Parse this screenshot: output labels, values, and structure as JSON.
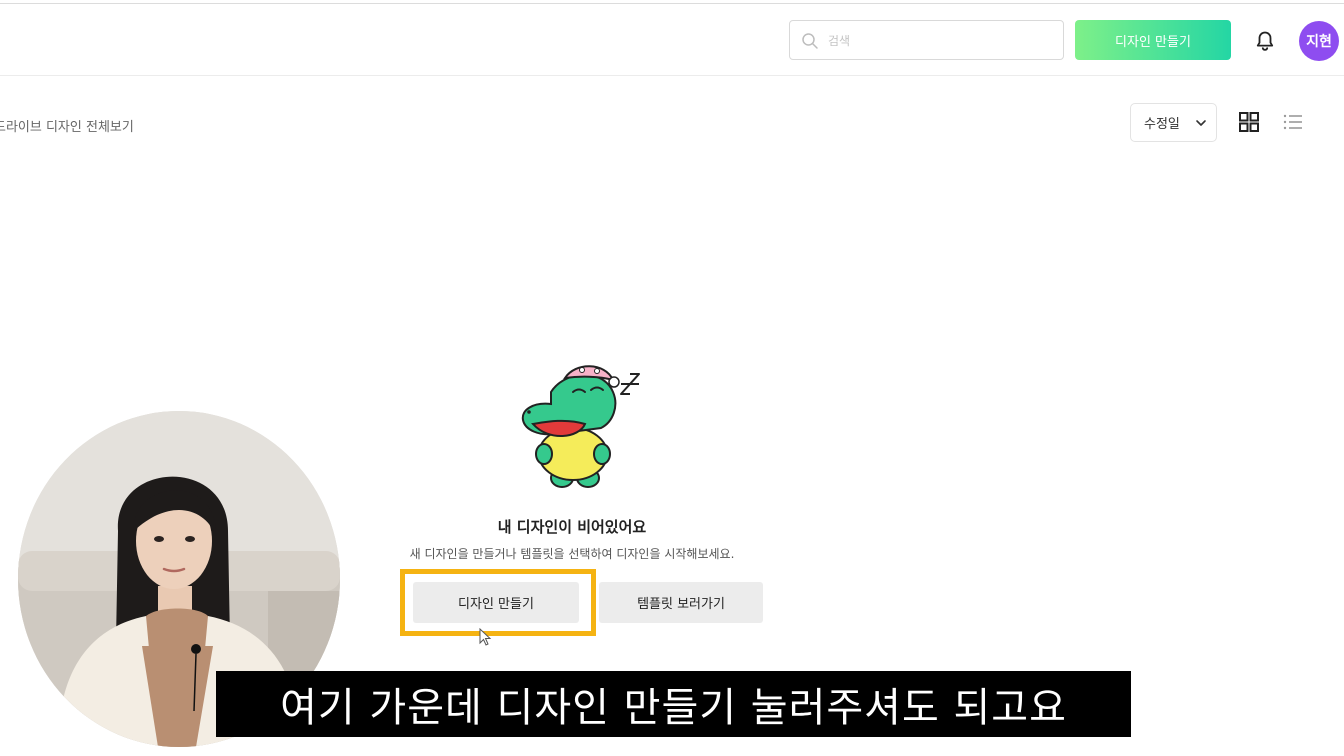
{
  "header": {
    "search_placeholder": "검색",
    "create_button": "디자인 만들기",
    "avatar_initials": "지현"
  },
  "toolbar": {
    "breadcrumb": "드라이브 디자인 전체보기",
    "sort_label": "수정일"
  },
  "empty_state": {
    "title": "내 디자인이 비어있어요",
    "description": "새 디자인을 만들거나 템플릿을 선택하여 디자인을 시작해보세요.",
    "create_button": "디자인 만들기",
    "templates_button": "템플릿 보러가기"
  },
  "subtitle": "여기 가운데 디자인 만들기 눌러주셔도 되고요",
  "icons": [
    "search-icon",
    "bell-icon",
    "chevron-down-icon",
    "grid-view-icon",
    "list-view-icon",
    "cursor-icon"
  ],
  "colors": {
    "create_gradient_start": "#7ef089",
    "create_gradient_end": "#24d6a4",
    "avatar": "#8e4df0",
    "highlight": "#f5b312",
    "mascot_green": "#35c98d",
    "mascot_yellow": "#f5ec5a"
  }
}
